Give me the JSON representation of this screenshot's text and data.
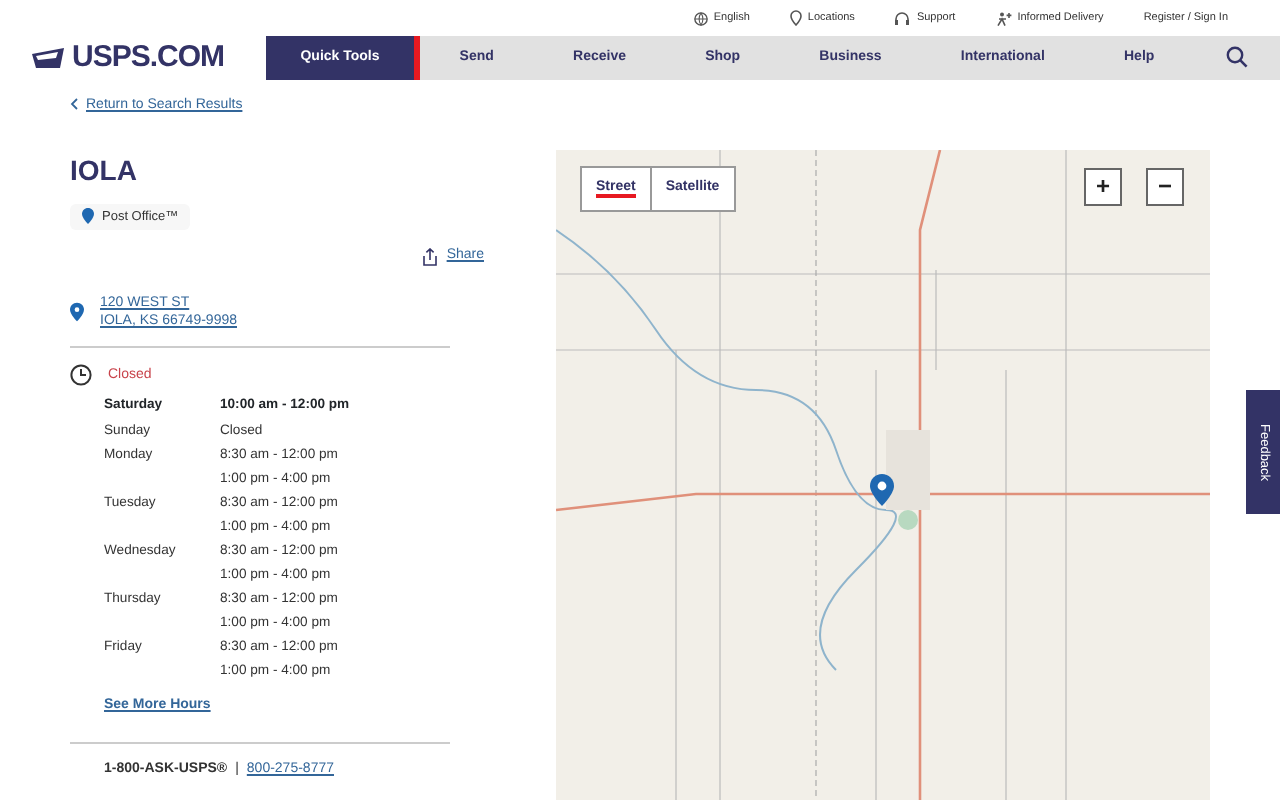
{
  "utility_links": [
    {
      "label": "English",
      "kind": "globe"
    },
    {
      "label": "Locations",
      "kind": "pin"
    },
    {
      "label": "Support",
      "kind": "headset"
    },
    {
      "label": "Informed Delivery",
      "kind": "delivery"
    },
    {
      "label": "Register / Sign In",
      "kind": "none"
    }
  ],
  "logo": {
    "text": "USPS.COM"
  },
  "nav": [
    {
      "label": "Quick Tools",
      "selected": true
    },
    {
      "label": "Send",
      "selected": false
    },
    {
      "label": "Receive",
      "selected": false
    },
    {
      "label": "Shop",
      "selected": false
    },
    {
      "label": "Business",
      "selected": false
    },
    {
      "label": "International",
      "selected": false
    },
    {
      "label": "Help",
      "selected": false
    }
  ],
  "back_link": "Return to Search Results",
  "title": "IOLA",
  "location_type": "Post Office™",
  "share": "Share",
  "address": [
    "120 WEST ST",
    "IOLA, KS 66749-9998"
  ],
  "status": "Closed",
  "hours": [
    {
      "day": "Saturday",
      "times": [
        "10:00 am - 12:00 pm"
      ],
      "today": true
    },
    {
      "day": "Sunday",
      "times": [
        "Closed"
      ],
      "today": false
    },
    {
      "day": "Monday",
      "times": [
        "8:30 am - 12:00 pm",
        "1:00 pm - 4:00 pm"
      ],
      "today": false
    },
    {
      "day": "Tuesday",
      "times": [
        "8:30 am - 12:00 pm",
        "1:00 pm - 4:00 pm"
      ],
      "today": false
    },
    {
      "day": "Wednesday",
      "times": [
        "8:30 am - 12:00 pm",
        "1:00 pm - 4:00 pm"
      ],
      "today": false
    },
    {
      "day": "Thursday",
      "times": [
        "8:30 am - 12:00 pm",
        "1:00 pm - 4:00 pm"
      ],
      "today": false
    },
    {
      "day": "Friday",
      "times": [
        "8:30 am - 12:00 pm",
        "1:00 pm - 4:00 pm"
      ],
      "today": false
    }
  ],
  "more_hours": "See More Hours",
  "phone": {
    "label": "1-800-ASK-USPS®",
    "separator": "|",
    "number": "800-275-8777"
  },
  "map": {
    "modes": [
      {
        "label": "Street",
        "selected": true
      },
      {
        "label": "Satellite",
        "selected": false
      }
    ],
    "zoom_in": "+",
    "zoom_out": "−"
  },
  "feedback": "Feedback"
}
